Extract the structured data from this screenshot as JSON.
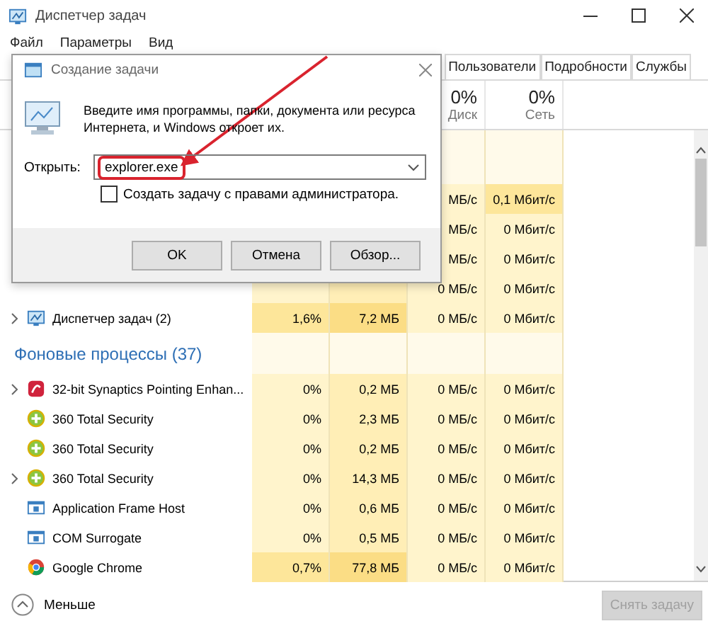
{
  "window": {
    "title": "Диспетчер задач"
  },
  "menu": [
    "Файл",
    "Параметры",
    "Вид"
  ],
  "tabs": [
    {
      "label": "Пользователи",
      "selected": false
    },
    {
      "label": "Подробности",
      "selected": false
    },
    {
      "label": "Службы",
      "selected": false
    }
  ],
  "columns": [
    {
      "percent": "0%",
      "label": "Диск"
    },
    {
      "percent": "0%",
      "label": "Сеть"
    }
  ],
  "rows": [
    {
      "kind": "covered",
      "cells": [
        {
          "text": "МБ/с",
          "hot": false
        },
        {
          "text": "0,1 Мбит/с",
          "hot": true
        }
      ]
    },
    {
      "kind": "covered",
      "cells": [
        {
          "text": "МБ/с",
          "hot": false
        },
        {
          "text": "0 Мбит/с",
          "hot": false
        }
      ]
    },
    {
      "kind": "covered",
      "cells": [
        {
          "text": "МБ/с",
          "hot": false
        },
        {
          "text": "0 Мбит/с",
          "hot": false
        }
      ]
    },
    {
      "kind": "covered",
      "cells": [
        {
          "text": "0 МБ/с",
          "hot": false
        },
        {
          "text": "0 Мбит/с",
          "hot": false
        }
      ]
    },
    {
      "kind": "process",
      "name": "Диспетчер задач (2)",
      "expandable": true,
      "cells": [
        {
          "text": "1,6%",
          "hot": true
        },
        {
          "text": "7,2 МБ",
          "hot": true
        },
        {
          "text": "0 МБ/с",
          "hot": false
        },
        {
          "text": "0 Мбит/с",
          "hot": false
        }
      ]
    },
    {
      "kind": "group",
      "label": "Фоновые процессы (37)"
    },
    {
      "kind": "process",
      "name": "32-bit Synaptics Pointing Enhan...",
      "expandable": true,
      "cells": [
        {
          "text": "0%",
          "hot": false
        },
        {
          "text": "0,2 МБ",
          "hot": false
        },
        {
          "text": "0 МБ/с",
          "hot": false
        },
        {
          "text": "0 Мбит/с",
          "hot": false
        }
      ]
    },
    {
      "kind": "process",
      "name": "360 Total Security",
      "expandable": false,
      "cells": [
        {
          "text": "0%",
          "hot": false
        },
        {
          "text": "2,3 МБ",
          "hot": false
        },
        {
          "text": "0 МБ/с",
          "hot": false
        },
        {
          "text": "0 Мбит/с",
          "hot": false
        }
      ]
    },
    {
      "kind": "process",
      "name": "360 Total Security",
      "expandable": false,
      "cells": [
        {
          "text": "0%",
          "hot": false
        },
        {
          "text": "0,2 МБ",
          "hot": false
        },
        {
          "text": "0 МБ/с",
          "hot": false
        },
        {
          "text": "0 Мбит/с",
          "hot": false
        }
      ]
    },
    {
      "kind": "process",
      "name": "360 Total Security",
      "expandable": true,
      "cells": [
        {
          "text": "0%",
          "hot": false
        },
        {
          "text": "14,3 МБ",
          "hot": false
        },
        {
          "text": "0 МБ/с",
          "hot": false
        },
        {
          "text": "0 Мбит/с",
          "hot": false
        }
      ]
    },
    {
      "kind": "process",
      "name": "Application Frame Host",
      "expandable": false,
      "cells": [
        {
          "text": "0%",
          "hot": false
        },
        {
          "text": "0,6 МБ",
          "hot": false
        },
        {
          "text": "0 МБ/с",
          "hot": false
        },
        {
          "text": "0 Мбит/с",
          "hot": false
        }
      ]
    },
    {
      "kind": "process",
      "name": "COM Surrogate",
      "expandable": false,
      "cells": [
        {
          "text": "0%",
          "hot": false
        },
        {
          "text": "0,5 МБ",
          "hot": false
        },
        {
          "text": "0 МБ/с",
          "hot": false
        },
        {
          "text": "0 Мбит/с",
          "hot": false
        }
      ]
    },
    {
      "kind": "process",
      "name": "Google Chrome",
      "expandable": false,
      "cells": [
        {
          "text": "0,7%",
          "hot": true
        },
        {
          "text": "77,8 МБ",
          "hot": true
        },
        {
          "text": "0 МБ/с",
          "hot": false
        },
        {
          "text": "0 Мбит/с",
          "hot": false
        }
      ]
    }
  ],
  "footer": {
    "less": "Меньше",
    "end_task": {
      "label": "Снять задачу",
      "disabled": true
    }
  },
  "dialog": {
    "title": "Создание задачи",
    "message": "Введите имя программы, папки, документа или ресурса Интернета, и Windows откроет их.",
    "open_label": "Открыть:",
    "open_value": "explorer.exe",
    "admin_checkbox": {
      "label": "Создать задачу с правами администратора.",
      "checked": false
    },
    "buttons": [
      "OK",
      "Отмена",
      "Обзор..."
    ]
  }
}
